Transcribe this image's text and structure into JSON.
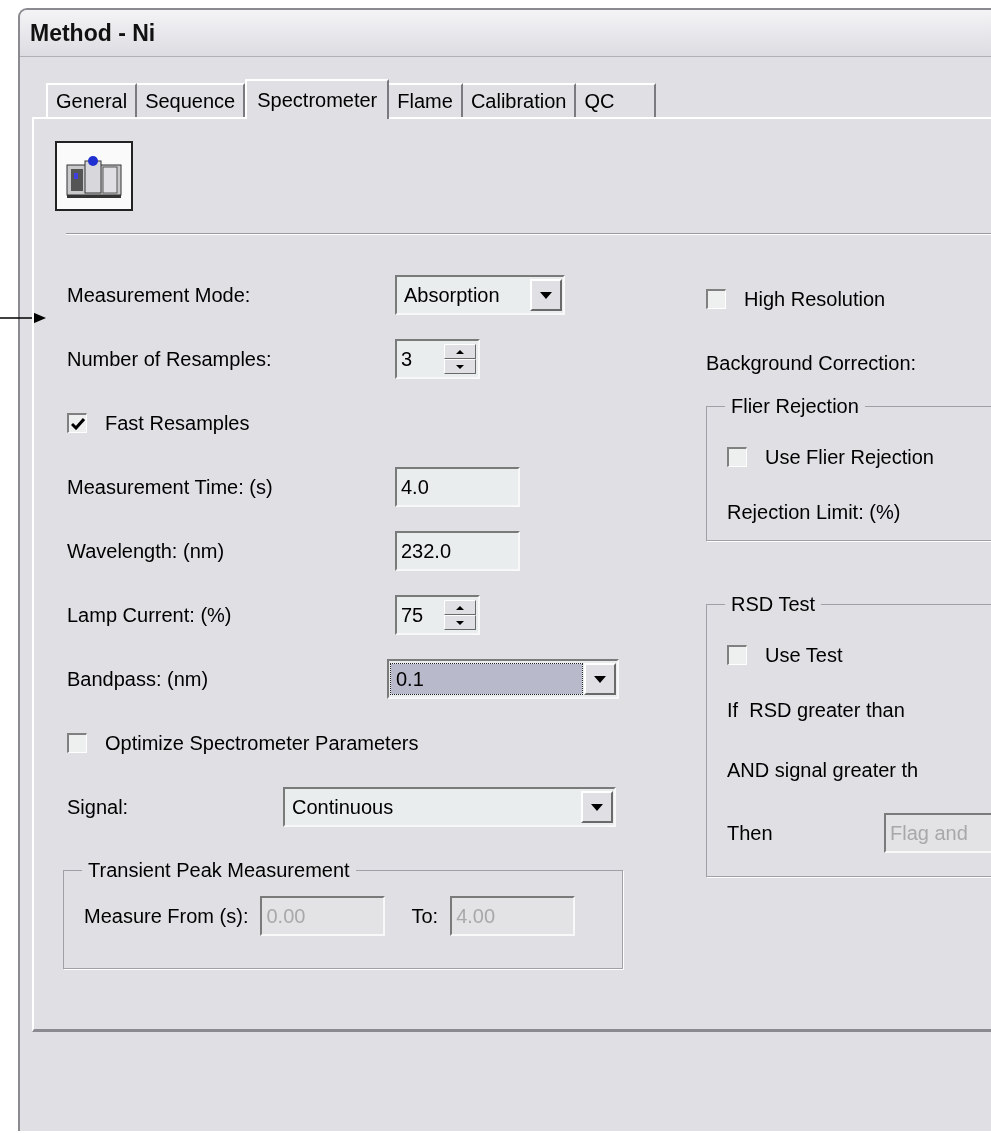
{
  "window": {
    "title": "Method - Ni"
  },
  "tabs": [
    {
      "label": "General",
      "selected": false
    },
    {
      "label": "Sequence",
      "selected": false
    },
    {
      "label": "Spectrometer",
      "selected": true
    },
    {
      "label": "Flame",
      "selected": false
    },
    {
      "label": "Calibration",
      "selected": false
    },
    {
      "label": "QC",
      "selected": false
    }
  ],
  "left_fields": [
    {
      "kind": "dropdown",
      "label": "Measurement Mode:",
      "value": "Absorption",
      "focused": false
    },
    {
      "kind": "spinner",
      "label": "Number of Resamples:",
      "value": "3"
    },
    {
      "kind": "checkbox",
      "label": "Fast Resamples",
      "checked": true
    },
    {
      "kind": "textbox",
      "label": "Measurement Time: (s)",
      "value": "4.0"
    },
    {
      "kind": "textbox",
      "label": "Wavelength: (nm)",
      "value": "232.0"
    },
    {
      "kind": "spinner",
      "label": "Lamp Current: (%)",
      "value": "75"
    },
    {
      "kind": "wide",
      "label": "Bandpass: (nm)",
      "value": "0.1",
      "focused": true
    },
    {
      "kind": "checkbox",
      "label": "Optimize Spectrometer Parameters",
      "checked": false
    },
    {
      "kind": "signal",
      "label": "Signal:",
      "value": "Continuous",
      "focused": false
    }
  ],
  "transient_peak": {
    "title": "Transient Peak Measurement",
    "fields": [
      {
        "label": "Measure From (s):",
        "value": "0.00",
        "disabled": true
      },
      {
        "label": "To:",
        "value": "4.00",
        "disabled": true
      }
    ]
  },
  "high_resolution": {
    "label": "High Resolution",
    "checked": false
  },
  "background_correction": {
    "label": "Background Correction:"
  },
  "flier_rejection": {
    "title": "Flier Rejection",
    "use": {
      "label": "Use Flier Rejection",
      "checked": false
    },
    "limit_label": "Rejection Limit: (%)"
  },
  "rsd_test": {
    "title": "RSD Test",
    "use": {
      "label": "Use Test",
      "checked": false
    },
    "if_label": "If  RSD greater than",
    "and_label": "AND signal greater th",
    "then_label": "Then",
    "then_value": "Flag and",
    "then_disabled": true
  }
}
